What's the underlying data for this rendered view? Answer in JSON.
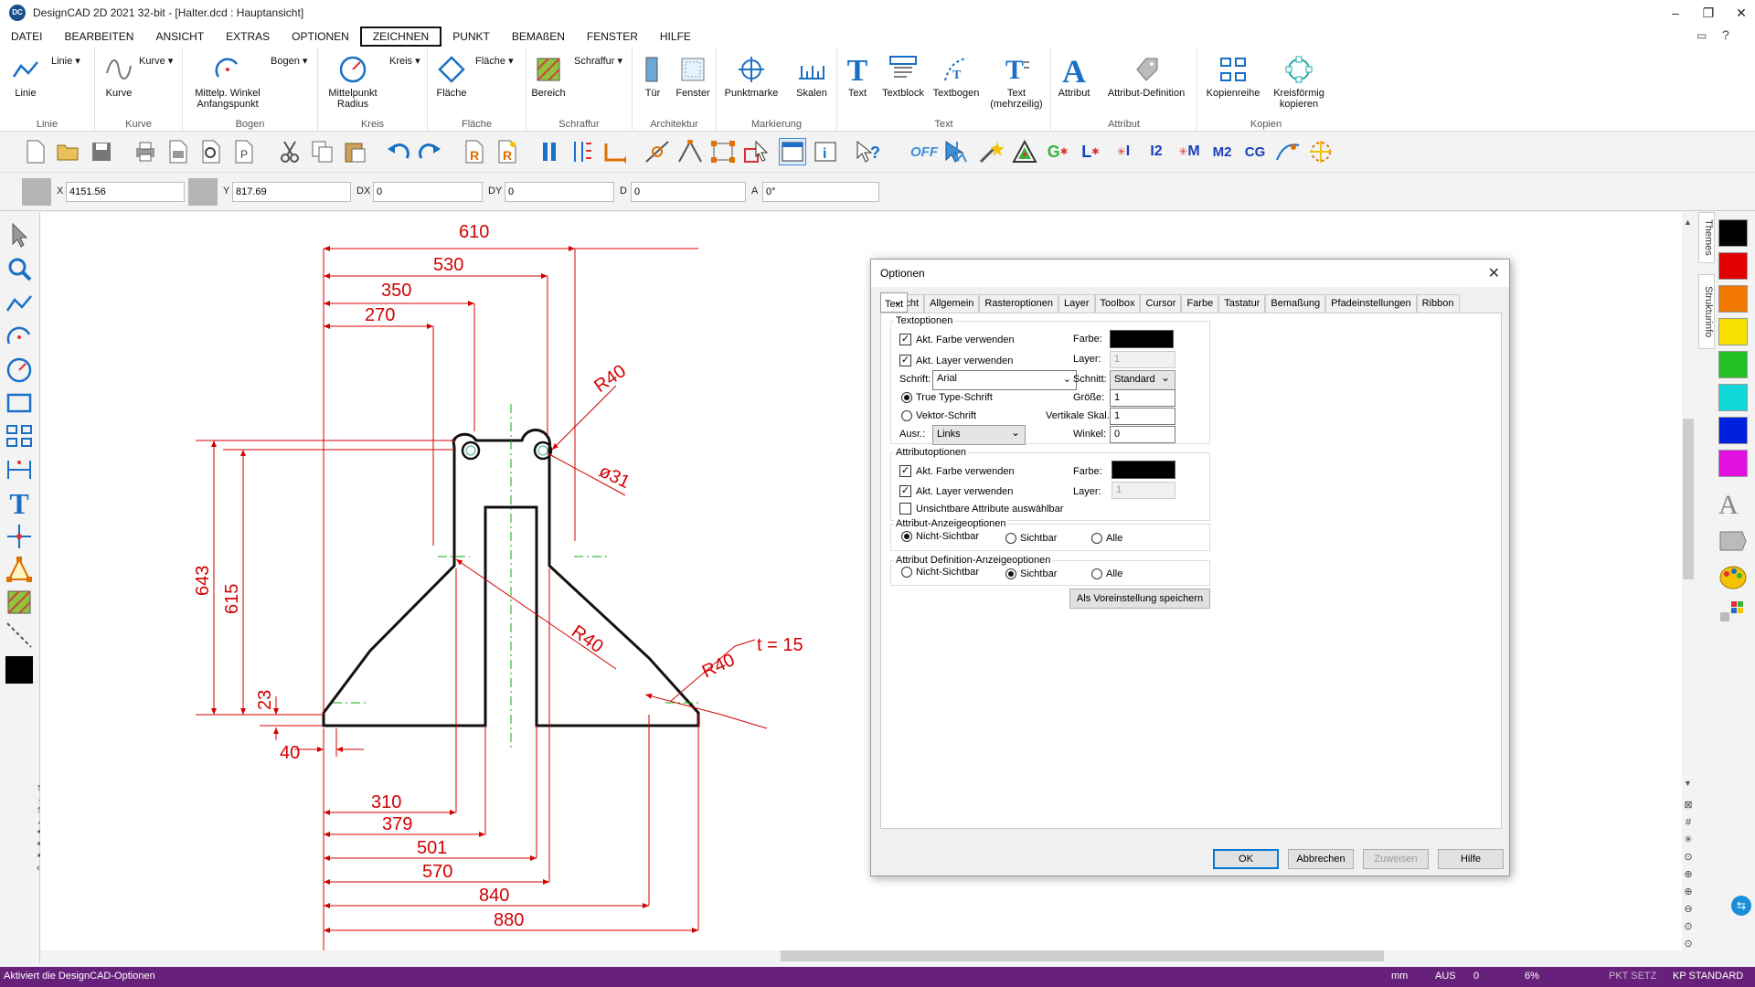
{
  "titlebar": {
    "title": "DesignCAD 2D 2021 32-bit - [Halter.dcd : Hauptansicht]",
    "app_icon": "DC"
  },
  "menus": [
    "DATEI",
    "BEARBEITEN",
    "ANSICHT",
    "EXTRAS",
    "OPTIONEN",
    "ZEICHNEN",
    "PUNKT",
    "BEMAßEN",
    "FENSTER",
    "HILFE"
  ],
  "ribbon": {
    "groups": {
      "linie": {
        "label": "Linie",
        "btn": "Linie",
        "drop": "Linie"
      },
      "kurve": {
        "label": "Kurve",
        "btn": "Kurve",
        "drop": "Kurve"
      },
      "bogen": {
        "label": "Bogen",
        "btn": "Mittelp. Winkel Anfangspunkt",
        "drop": "Bogen"
      },
      "kreis": {
        "label": "Kreis",
        "btn": "Mittelpunkt Radius",
        "drop": "Kreis"
      },
      "flaeche": {
        "label": "Fläche",
        "btn": "Fläche",
        "drop": "Fläche"
      },
      "schraffur": {
        "label": "Schraffur",
        "btn": "Bereich",
        "drop": "Schraffur"
      },
      "architektur": {
        "label": "Architektur",
        "btn1": "Tür",
        "btn2": "Fenster"
      },
      "markierung": {
        "label": "Markierung",
        "btn1": "Punktmarke",
        "btn2": "Skalen"
      },
      "text": {
        "label": "Text",
        "btn1": "Text",
        "btn2": "Textblock",
        "btn3": "Textbogen",
        "btn4": "Text (mehrzeilig)"
      },
      "attribut": {
        "label": "Attribut",
        "btn1": "Attribut",
        "btn2": "Attribut-Definition"
      },
      "kopien": {
        "label": "Kopien",
        "btn1": "Kopienreihe",
        "btn2": "Kreisförmig kopieren"
      }
    }
  },
  "coords": {
    "x_label": "X",
    "x": "4151.56",
    "y_label": "Y",
    "y": "817.69",
    "dx_label": "DX",
    "dx": "0",
    "dy_label": "DY",
    "dy": "0",
    "d_label": "D",
    "d": "0",
    "a_label": "A",
    "a": "0°"
  },
  "drawing": {
    "dims_top": [
      "610",
      "530",
      "350",
      "270"
    ],
    "dims_bottom": [
      "310",
      "379",
      "501",
      "570",
      "840",
      "880"
    ],
    "dims_left": [
      "643",
      "615",
      "23",
      "40"
    ],
    "labels": {
      "r40_top": "R40",
      "d31": "ø31",
      "r40_mid": "R40",
      "r40_right": "R40",
      "thickness": "t = 15"
    },
    "color": "#d40000"
  },
  "right_panel": {
    "tab_themes": "Themes",
    "tab_struktur": "Strukturinfo",
    "colors": [
      "#000000",
      "#e00000",
      "#f07800",
      "#f5e000",
      "#22c022",
      "#10d8d8",
      "#0020e0",
      "#e010e0"
    ]
  },
  "statusbar": {
    "message": "Aktiviert die DesignCAD-Optionen",
    "unit": "mm",
    "mode": "AUS",
    "count": "0",
    "zoom": "6%",
    "pkt": "PKT SETZ",
    "kp": "KP STANDARD"
  },
  "dialog": {
    "title": "Optionen",
    "tabs": [
      "Ansicht",
      "Allgemein",
      "Rasteroptionen",
      "Layer",
      "Toolbox",
      "Cursor",
      "Farbe",
      "Tastatur",
      "Bemaßung",
      "Pfadeinstellungen",
      "Text",
      "Ribbon"
    ],
    "text_opts": {
      "legend": "Textoptionen",
      "use_color": "Akt. Farbe verwenden",
      "use_layer": "Akt. Layer verwenden",
      "font_label": "Schrift:",
      "font_value": "Arial",
      "truetype": "True Type-Schrift",
      "vector": "Vektor-Schrift",
      "align_label": "Ausr.:",
      "align_value": "Links",
      "color_label": "Farbe:",
      "layer_label": "Layer:",
      "layer_value": "1",
      "style_label": "Schnitt:",
      "style_value": "Standard",
      "size_label": "Größe:",
      "size_value": "1",
      "vscale_label": "Vertikale Skal.:",
      "vscale_value": "1",
      "angle_label": "Winkel:",
      "angle_value": "0"
    },
    "attr_opts": {
      "legend": "Attributoptionen",
      "use_color": "Akt. Farbe verwenden",
      "use_layer": "Akt. Layer verwenden",
      "invisible": "Unsichtbare Attribute auswählbar",
      "color_label": "Farbe:",
      "layer_label": "Layer:",
      "layer_value": "1"
    },
    "attr_display": {
      "legend": "Attribut-Anzeigeoptionen",
      "opt1": "Nicht-Sichtbar",
      "opt2": "Sichtbar",
      "opt3": "Alle"
    },
    "attr_def_display": {
      "legend": "Attribut Definition-Anzeigeoptionen",
      "opt1": "Nicht-Sichtbar",
      "opt2": "Sichtbar",
      "opt3": "Alle"
    },
    "save_default": "Als Voreinstellung speichern",
    "ok": "OK",
    "cancel": "Abbrechen",
    "apply": "Zuweisen",
    "help": "Hilfe"
  }
}
